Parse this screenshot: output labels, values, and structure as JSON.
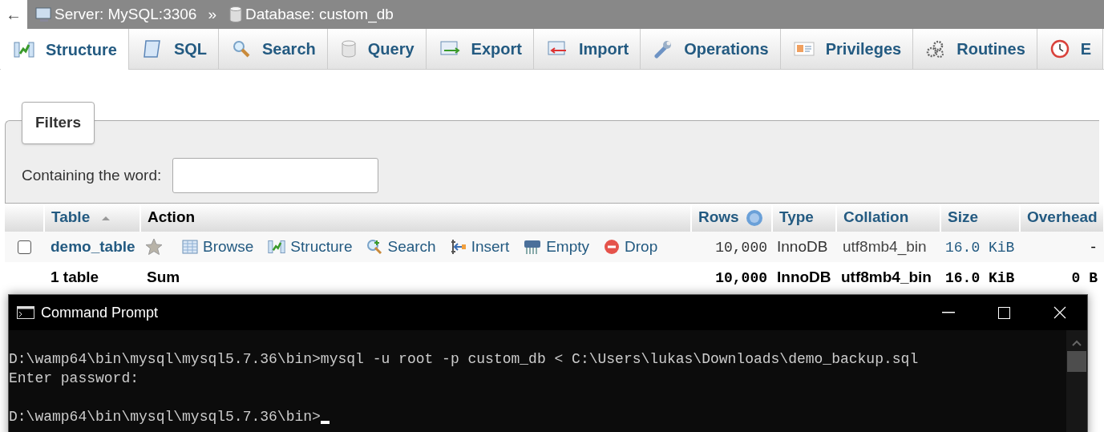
{
  "breadcrumb": {
    "back": "←",
    "server": "Server: MySQL:3306",
    "separator": "»",
    "database": "Database: custom_db"
  },
  "tabs": [
    {
      "label": "Structure",
      "selected": true
    },
    {
      "label": "SQL",
      "selected": false
    },
    {
      "label": "Search",
      "selected": false
    },
    {
      "label": "Query",
      "selected": false
    },
    {
      "label": "Export",
      "selected": false
    },
    {
      "label": "Import",
      "selected": false
    },
    {
      "label": "Operations",
      "selected": false
    },
    {
      "label": "Privileges",
      "selected": false
    },
    {
      "label": "Routines",
      "selected": false
    },
    {
      "label": "E",
      "selected": false
    }
  ],
  "filters": {
    "legend": "Filters",
    "label": "Containing the word:"
  },
  "table": {
    "columns": [
      "Table",
      "Action",
      "Rows",
      "Type",
      "Collation",
      "Size",
      "Overhead"
    ],
    "rows": [
      {
        "checked": false,
        "name": "demo_table",
        "actions": [
          "Browse",
          "Structure",
          "Search",
          "Insert",
          "Empty",
          "Drop"
        ],
        "rows": "10,000",
        "type": "InnoDB",
        "collation": "utf8mb4_bin",
        "size": "16.0 KiB",
        "overhead": "-"
      }
    ],
    "footer": {
      "count": "1 table",
      "label": "Sum",
      "rows": "10,000",
      "type": "InnoDB",
      "collation": "utf8mb4_bin",
      "size": "16.0 KiB",
      "overhead": "0 B"
    }
  },
  "console": {
    "title": "Command Prompt",
    "blocks": [
      [
        "D:\\wamp64\\bin\\mysql\\mysql5.7.36\\bin>mysql -u root -p custom_db < C:\\Users\\lukas\\Downloads\\demo_backup.sql",
        "Enter password:"
      ],
      [
        "D:\\wamp64\\bin\\mysql\\mysql5.7.36\\bin>"
      ]
    ]
  }
}
